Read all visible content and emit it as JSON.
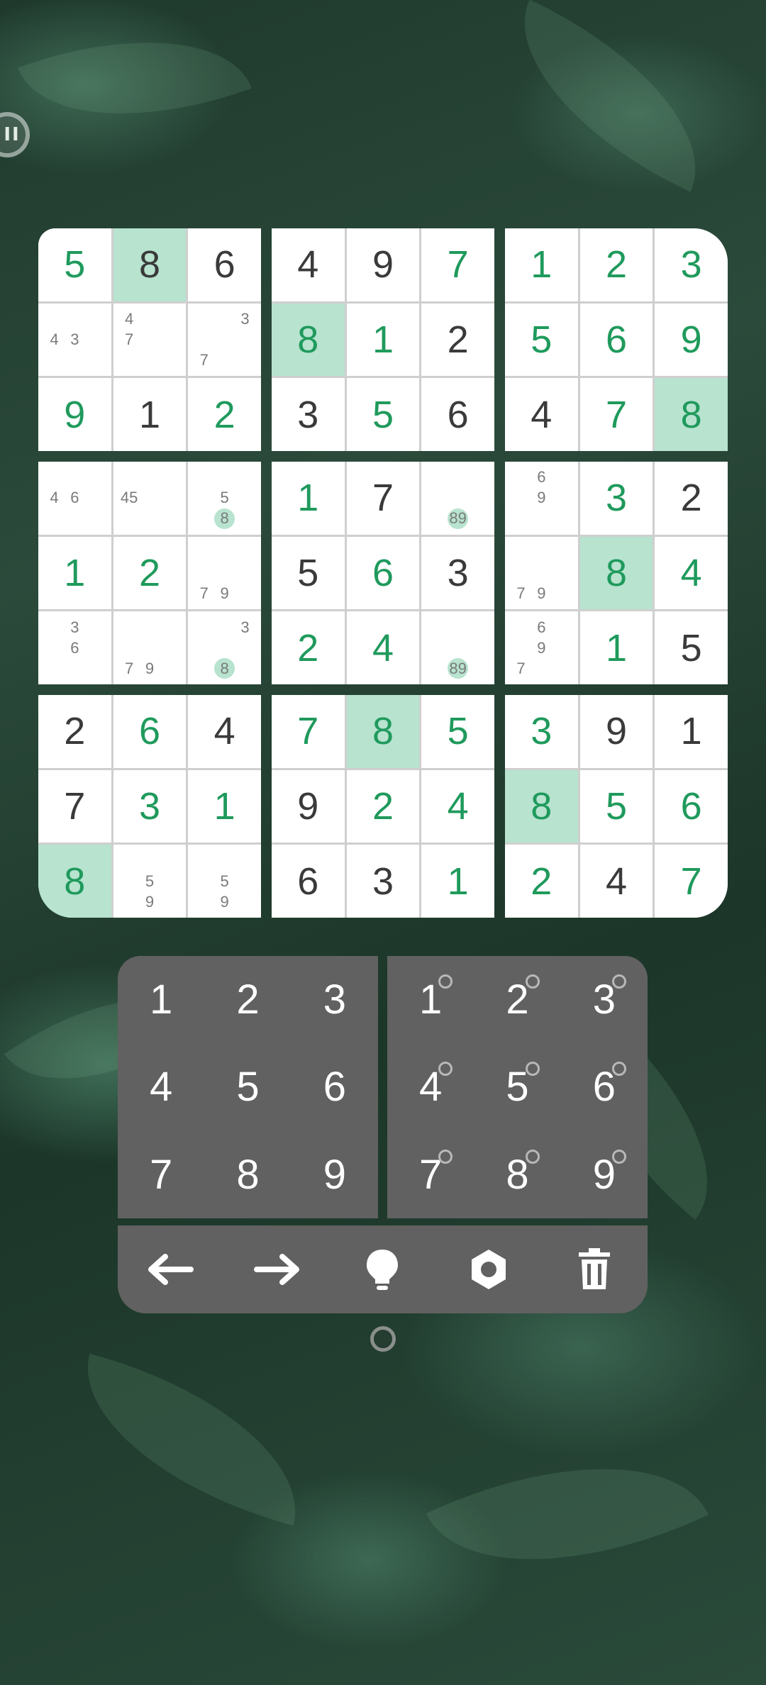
{
  "board": {
    "blocks": [
      [
        {
          "v": "5",
          "t": "entered"
        },
        {
          "v": "8",
          "t": "given",
          "hl": true
        },
        {
          "v": "6",
          "t": "given"
        },
        {
          "notes": [
            "",
            "",
            "",
            "4",
            "3",
            "",
            "",
            "",
            ""
          ]
        },
        {
          "notes": [
            "4",
            "",
            "",
            "7",
            "",
            "",
            "",
            "",
            ""
          ]
        },
        {
          "notes": [
            "",
            "",
            "3",
            "",
            "",
            "",
            "7",
            "",
            ""
          ]
        },
        {
          "v": "9",
          "t": "entered"
        },
        {
          "v": "1",
          "t": "given"
        },
        {
          "v": "2",
          "t": "entered"
        }
      ],
      [
        {
          "v": "4",
          "t": "given"
        },
        {
          "v": "9",
          "t": "given"
        },
        {
          "v": "7",
          "t": "entered"
        },
        {
          "v": "8",
          "t": "entered",
          "hl": true
        },
        {
          "v": "1",
          "t": "entered"
        },
        {
          "v": "2",
          "t": "given"
        },
        {
          "v": "3",
          "t": "given"
        },
        {
          "v": "5",
          "t": "entered"
        },
        {
          "v": "6",
          "t": "given"
        }
      ],
      [
        {
          "v": "1",
          "t": "entered"
        },
        {
          "v": "2",
          "t": "entered"
        },
        {
          "v": "3",
          "t": "entered"
        },
        {
          "v": "5",
          "t": "entered"
        },
        {
          "v": "6",
          "t": "entered"
        },
        {
          "v": "9",
          "t": "entered"
        },
        {
          "v": "4",
          "t": "given"
        },
        {
          "v": "7",
          "t": "entered"
        },
        {
          "v": "8",
          "t": "entered",
          "hl": true
        }
      ],
      [
        {
          "notes": [
            "",
            "",
            "",
            "4",
            "6",
            "",
            "",
            "",
            ""
          ]
        },
        {
          "notes": [
            "",
            "",
            "",
            "45",
            "",
            "",
            "",
            "",
            ""
          ]
        },
        {
          "notes": [
            "",
            "",
            "",
            "",
            "5",
            "",
            "",
            "8",
            "",
            ""
          ],
          "mark": 7
        },
        {
          "v": "1",
          "t": "entered"
        },
        {
          "v": "2",
          "t": "entered"
        },
        {
          "notes": [
            "",
            "",
            "",
            "",
            "",
            "",
            "7",
            "9",
            ""
          ]
        },
        {
          "notes": [
            "",
            "3",
            "",
            "",
            "6",
            "",
            "",
            "",
            ""
          ]
        },
        {
          "notes": [
            "",
            "",
            "",
            "",
            "",
            "",
            "7",
            "9",
            ""
          ]
        },
        {
          "notes": [
            "",
            "",
            "3",
            "",
            "",
            "",
            "",
            "8",
            ""
          ],
          "mark": 7
        }
      ],
      [
        {
          "v": "1",
          "t": "entered"
        },
        {
          "v": "7",
          "t": "given"
        },
        {
          "notes": [
            "",
            "",
            "",
            "",
            "",
            "",
            "",
            "89",
            ""
          ],
          "mark": 7
        },
        {
          "v": "5",
          "t": "given"
        },
        {
          "v": "6",
          "t": "entered"
        },
        {
          "v": "3",
          "t": "given"
        },
        {
          "v": "2",
          "t": "entered"
        },
        {
          "v": "4",
          "t": "entered"
        },
        {
          "notes": [
            "",
            "",
            "",
            "",
            "",
            "",
            "",
            "89",
            ""
          ],
          "mark": 7
        }
      ],
      [
        {
          "notes": [
            "",
            "6",
            "",
            "",
            "9",
            "",
            "",
            "",
            ""
          ]
        },
        {
          "v": "3",
          "t": "entered"
        },
        {
          "v": "2",
          "t": "given"
        },
        {
          "notes": [
            "",
            "",
            "",
            "",
            "",
            "",
            "7",
            "9",
            ""
          ]
        },
        {
          "v": "8",
          "t": "entered",
          "hl": true
        },
        {
          "v": "4",
          "t": "entered"
        },
        {
          "notes": [
            "",
            "6",
            "",
            "",
            "9",
            "",
            "7",
            "",
            ""
          ]
        },
        {
          "v": "1",
          "t": "entered"
        },
        {
          "v": "5",
          "t": "given"
        }
      ],
      [
        {
          "v": "2",
          "t": "given"
        },
        {
          "v": "6",
          "t": "entered"
        },
        {
          "v": "4",
          "t": "given"
        },
        {
          "v": "7",
          "t": "given"
        },
        {
          "v": "3",
          "t": "entered"
        },
        {
          "v": "1",
          "t": "entered"
        },
        {
          "v": "8",
          "t": "entered",
          "hl": true
        },
        {
          "notes": [
            "",
            "",
            "",
            "",
            "5",
            "",
            "",
            "9",
            ""
          ]
        },
        {
          "notes": [
            "",
            "",
            "",
            "",
            "5",
            "",
            "",
            "9",
            ""
          ]
        }
      ],
      [
        {
          "v": "7",
          "t": "entered"
        },
        {
          "v": "8",
          "t": "entered",
          "hl": true
        },
        {
          "v": "5",
          "t": "entered"
        },
        {
          "v": "9",
          "t": "given"
        },
        {
          "v": "2",
          "t": "entered"
        },
        {
          "v": "4",
          "t": "entered"
        },
        {
          "v": "6",
          "t": "given"
        },
        {
          "v": "3",
          "t": "given"
        },
        {
          "v": "1",
          "t": "entered"
        }
      ],
      [
        {
          "v": "3",
          "t": "entered"
        },
        {
          "v": "9",
          "t": "given"
        },
        {
          "v": "1",
          "t": "given"
        },
        {
          "v": "8",
          "t": "entered",
          "hl": true
        },
        {
          "v": "5",
          "t": "entered"
        },
        {
          "v": "6",
          "t": "entered"
        },
        {
          "v": "2",
          "t": "entered"
        },
        {
          "v": "4",
          "t": "given"
        },
        {
          "v": "7",
          "t": "entered"
        }
      ]
    ]
  },
  "keypad": {
    "digits": [
      "1",
      "2",
      "3",
      "4",
      "5",
      "6",
      "7",
      "8",
      "9"
    ],
    "notes": [
      "1",
      "2",
      "3",
      "4",
      "5",
      "6",
      "7",
      "8",
      "9"
    ]
  },
  "toolbar": {
    "icons": [
      "arrow-left-icon",
      "arrow-right-icon",
      "lightbulb-icon",
      "settings-icon",
      "trash-icon"
    ]
  },
  "colors": {
    "entered": "#1f9a5c",
    "given": "#3a3a3a",
    "highlight": "#b7e3cf",
    "pad": "#616161"
  }
}
